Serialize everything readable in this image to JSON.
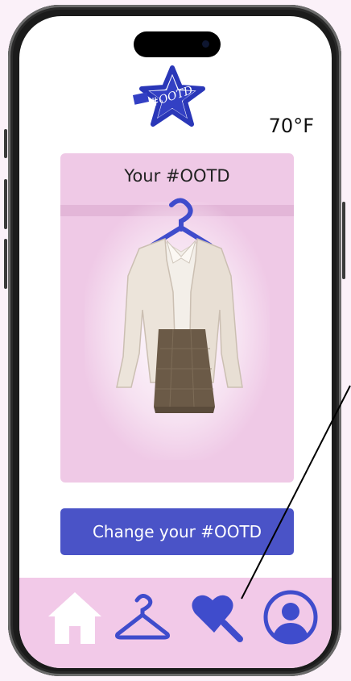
{
  "header": {
    "logo_text": "#OOTD",
    "temperature": "70°F"
  },
  "outfit_card": {
    "title": "Your #OOTD",
    "image_desc_icon": "hanger-icon"
  },
  "actions": {
    "change_label": "Change your #OOTD"
  },
  "nav": {
    "items": [
      {
        "icon": "home-icon"
      },
      {
        "icon": "hanger-icon"
      },
      {
        "icon": "heart-search-icon"
      },
      {
        "icon": "profile-icon"
      }
    ]
  },
  "colors": {
    "accent": "#4a53c7",
    "card_bg": "#efc9e6",
    "nav_bg": "#f2c9e8"
  }
}
